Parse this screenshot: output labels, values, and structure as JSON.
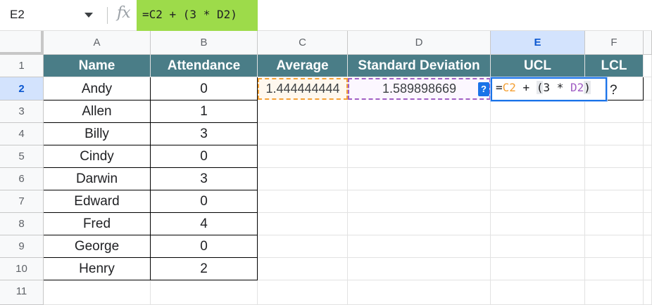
{
  "formula_bar": {
    "cell_ref": "E2",
    "fx_label": "fx",
    "formula": "=C2 + (3 * D2)"
  },
  "columns": [
    "A",
    "B",
    "C",
    "D",
    "E",
    "F"
  ],
  "rows": [
    "1",
    "2",
    "3",
    "4",
    "5",
    "6",
    "7",
    "8",
    "9",
    "10",
    "11"
  ],
  "headers": {
    "name": "Name",
    "attendance": "Attendance",
    "average": "Average",
    "std_dev": "Standard Deviation",
    "ucl": "UCL",
    "lcl": "LCL"
  },
  "data": [
    {
      "name": "Andy",
      "attendance": "0"
    },
    {
      "name": "Allen",
      "attendance": "1"
    },
    {
      "name": "Billy",
      "attendance": "3"
    },
    {
      "name": "Cindy",
      "attendance": "0"
    },
    {
      "name": "Darwin",
      "attendance": "3"
    },
    {
      "name": "Edward",
      "attendance": "0"
    },
    {
      "name": "Fred",
      "attendance": "4"
    },
    {
      "name": "George",
      "attendance": "0"
    },
    {
      "name": "Henry",
      "attendance": "2"
    }
  ],
  "row2": {
    "average": "1.444444444",
    "std_dev": "1.589898669",
    "lcl": "?",
    "help_badge": "?",
    "formula_tokens": {
      "eq": "=",
      "c2": "C2",
      "plus": " + ",
      "open": "(",
      "mid": "3 * ",
      "d2": "D2",
      "close": ")"
    }
  },
  "colors": {
    "header_fill": "#4a7d87",
    "formula_bar_fill": "#9ddb4a",
    "selection_blue": "#1a73e8",
    "ref_c2": "#f4a034",
    "ref_d2": "#a05ec4"
  }
}
